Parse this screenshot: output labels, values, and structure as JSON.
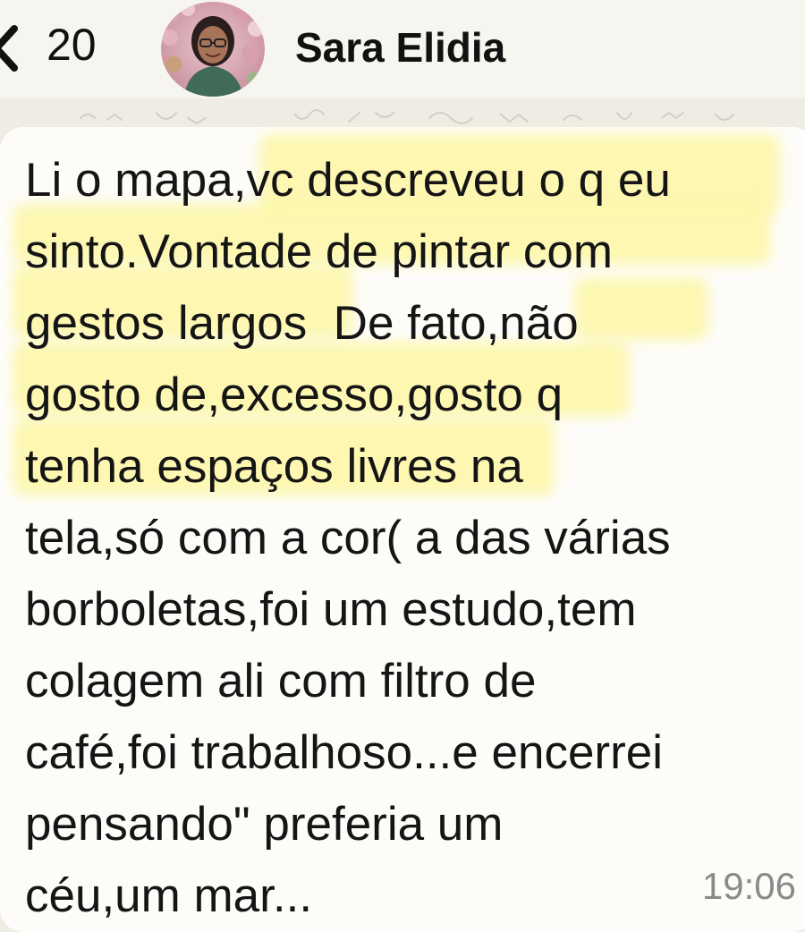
{
  "header": {
    "back_icon": "chevron-left-icon",
    "unread_count": "20",
    "contact_name": "Sara Elidia",
    "avatar": "avatar-photo"
  },
  "message": {
    "lines": [
      "Li o mapa,vc descreveu o q eu",
      "sinto.Vontade de pintar com",
      "gestos largos  De fato,não",
      "gosto de,excesso,gosto q",
      "tenha espaços livres na",
      "tela,só com a cor( a das várias",
      "borboletas,foi um estudo,tem",
      "colagem ali com filtro de",
      "café,foi trabalhoso...e encerrei",
      "pensando\" preferia um",
      "céu,um mar..."
    ],
    "time": "19:06"
  },
  "colors": {
    "background": "#efece4",
    "bubble": "#fdfcf9",
    "highlight": "#fdf7a6",
    "text": "#151515",
    "timestamp": "#8a8a8a"
  }
}
